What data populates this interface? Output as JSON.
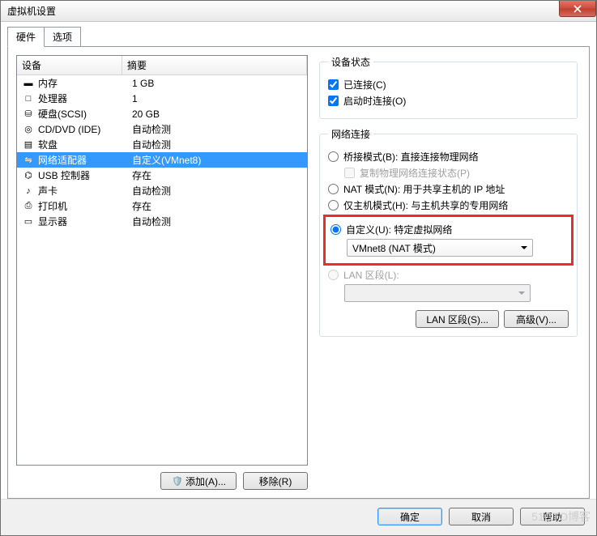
{
  "window": {
    "title": "虚拟机设置"
  },
  "tabs": {
    "hardware": "硬件",
    "options": "选项"
  },
  "list": {
    "head_device": "设备",
    "head_summary": "摘要",
    "rows": [
      {
        "icon": "memory-icon",
        "name": "内存",
        "summary": "1 GB"
      },
      {
        "icon": "cpu-icon",
        "name": "处理器",
        "summary": "1"
      },
      {
        "icon": "disk-icon",
        "name": "硬盘(SCSI)",
        "summary": "20 GB"
      },
      {
        "icon": "cd-icon",
        "name": "CD/DVD (IDE)",
        "summary": "自动检测"
      },
      {
        "icon": "floppy-icon",
        "name": "软盘",
        "summary": "自动检测"
      },
      {
        "icon": "network-icon",
        "name": "网络适配器",
        "summary": "自定义(VMnet8)"
      },
      {
        "icon": "usb-icon",
        "name": "USB 控制器",
        "summary": "存在"
      },
      {
        "icon": "sound-icon",
        "name": "声卡",
        "summary": "自动检测"
      },
      {
        "icon": "printer-icon",
        "name": "打印机",
        "summary": "存在"
      },
      {
        "icon": "display-icon",
        "name": "显示器",
        "summary": "自动检测"
      }
    ],
    "selected_index": 5
  },
  "btns": {
    "add": "添加(A)...",
    "remove": "移除(R)",
    "lan_seg": "LAN 区段(S)...",
    "advanced": "高级(V)..."
  },
  "status": {
    "legend": "设备状态",
    "connected": "已连接(C)",
    "connect_at_power": "启动时连接(O)"
  },
  "net": {
    "legend": "网络连接",
    "bridged": "桥接模式(B): 直接连接物理网络",
    "replicate": "复制物理网络连接状态(P)",
    "nat": "NAT 模式(N): 用于共享主机的 IP 地址",
    "hostonly": "仅主机模式(H): 与主机共享的专用网络",
    "custom": "自定义(U): 特定虚拟网络",
    "custom_value": "VMnet8 (NAT 模式)",
    "lanseg": "LAN 区段(L):"
  },
  "footer": {
    "ok": "确定",
    "cancel": "取消",
    "help": "帮助"
  },
  "watermark": "51CTO博客"
}
